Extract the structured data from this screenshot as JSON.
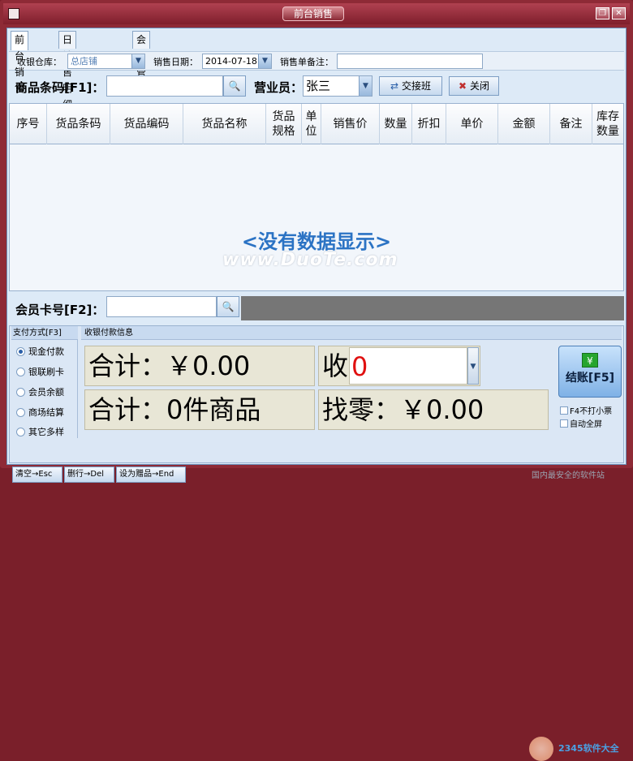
{
  "window": {
    "title": "前台销售"
  },
  "tabs": [
    "前台销售",
    "日销售明细查询",
    "会员管理"
  ],
  "row1": {
    "warehouse_label": "收银仓库：",
    "warehouse_value": "总店铺",
    "date_label": "销售日期：",
    "date_value": "2014-07-18",
    "note_label": "销售单备注：",
    "note_value": ""
  },
  "row2": {
    "barcode_label": "商品条码[F1]：",
    "barcode_value": "",
    "clerk_label": "营业员：",
    "clerk_value": "张三",
    "handover_button": "交接班",
    "close_button": "关闭"
  },
  "grid": {
    "columns": [
      "序号",
      "货品条码",
      "货品编码",
      "货品名称",
      "货品规格",
      "单位",
      "销售价",
      "数量",
      "折扣",
      "单价",
      "金额",
      "备注",
      "库存数量"
    ],
    "empty_text": "<没有数据显示>",
    "watermark": "www.DuoTe.com"
  },
  "member": {
    "card_label": "会员卡号[F2]：",
    "card_value": ""
  },
  "payment": {
    "methods_header": "支付方式[F3]",
    "methods": [
      {
        "label": "现金付款",
        "selected": true
      },
      {
        "label": "银联刷卡",
        "selected": false
      },
      {
        "label": "会员余额",
        "selected": false
      },
      {
        "label": "商场结算",
        "selected": false
      },
      {
        "label": "其它多样",
        "selected": false
      }
    ],
    "info_header": "收银付款信息",
    "total_text": "合计：￥0.00",
    "received_label": "收款：￥",
    "received_value": "0",
    "count_text": "合计：0件商品",
    "change_text": "找零：￥0.00",
    "checkout_label": "结账[F5]",
    "checkout_icon_text": "¥",
    "no_print_label": "F4不打小票",
    "fullscreen_label": "自动全屏"
  },
  "bottom_buttons": [
    "清空→Esc",
    "删行→Del",
    "设为赠品→End"
  ],
  "watermark_site": "国内最安全的软件站",
  "watermark_brand": "2345软件大全",
  "colors": {
    "title_bar": "#8e2a36",
    "empty_text": "#2b73c4",
    "received_value": "#e01010"
  }
}
